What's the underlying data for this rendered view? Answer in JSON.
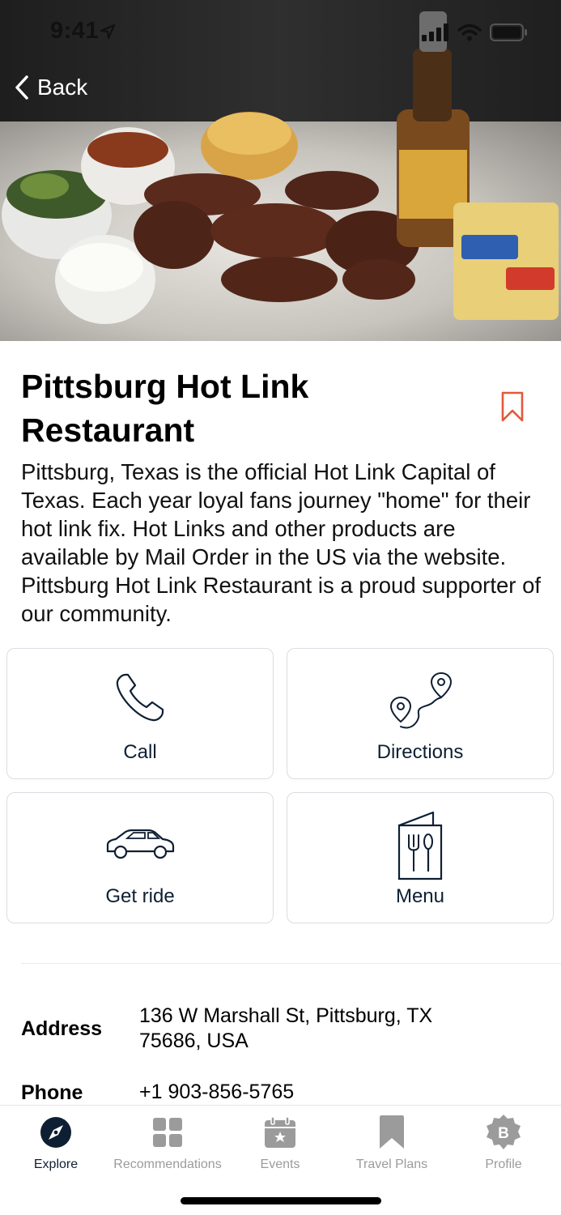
{
  "status_bar": {
    "time": "9:41"
  },
  "nav": {
    "back_label": "Back"
  },
  "place": {
    "title": "Pittsburg Hot Link Restaurant",
    "description": "Pittsburg, Texas is the official Hot Link Capital of Texas. Each year loyal fans journey \"home\" for their hot link fix. Hot Links and other products are available by Mail Order in the US via the website. Pittsburg Hot Link Restaurant is a proud supporter of our community.",
    "bookmark_icon": "bookmark-outline-icon"
  },
  "actions": {
    "call": "Call",
    "directions": "Directions",
    "get_ride": "Get ride",
    "menu": "Menu"
  },
  "info": {
    "address_label": "Address",
    "address_value": "136 W Marshall St, Pittsburg, TX 75686, USA",
    "phone_label": "Phone",
    "phone_value": "+1 903-856-5765"
  },
  "tabs": [
    {
      "label": "Explore",
      "icon": "compass-icon",
      "active": true
    },
    {
      "label": "Recommendations",
      "icon": "grid-icon",
      "active": false
    },
    {
      "label": "Events",
      "icon": "calendar-icon",
      "active": false
    },
    {
      "label": "Travel Plans",
      "icon": "bookmark-icon",
      "active": false
    },
    {
      "label": "Profile",
      "icon": "badge-icon",
      "active": false
    }
  ],
  "colors": {
    "accent": "#e2593b",
    "navy": "#0e1f33",
    "tab_inactive": "#9b9b9b",
    "card_border": "#d9dde2"
  }
}
